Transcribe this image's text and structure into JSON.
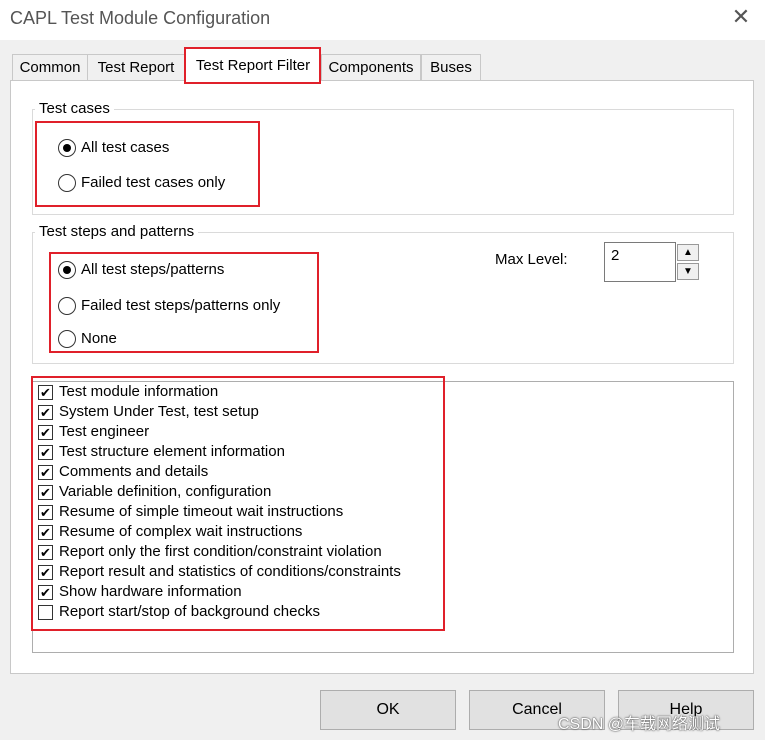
{
  "window": {
    "title": "CAPL Test Module Configuration",
    "close_glyph": "✕"
  },
  "tabs": [
    {
      "label": "Common"
    },
    {
      "label": "Test Report"
    },
    {
      "label": "Test Report Filter"
    },
    {
      "label": "Components"
    },
    {
      "label": "Buses"
    }
  ],
  "active_tab": "Test Report Filter",
  "test_cases": {
    "legend": "Test cases",
    "options": [
      {
        "label": "All test cases",
        "selected": true
      },
      {
        "label": "Failed test cases only",
        "selected": false
      }
    ]
  },
  "test_steps": {
    "legend": "Test steps and patterns",
    "options": [
      {
        "label": "All test steps/patterns",
        "selected": true
      },
      {
        "label": "Failed test steps/patterns only",
        "selected": false
      },
      {
        "label": "None",
        "selected": false
      }
    ],
    "max_level_label": "Max Level:",
    "max_level_value": "2"
  },
  "checklist": [
    {
      "label": "Test module information",
      "checked": true
    },
    {
      "label": "System Under Test, test setup",
      "checked": true
    },
    {
      "label": "Test engineer",
      "checked": true
    },
    {
      "label": "Test structure element information",
      "checked": true
    },
    {
      "label": "Comments and details",
      "checked": true
    },
    {
      "label": "Variable definition, configuration",
      "checked": true
    },
    {
      "label": "Resume of simple timeout wait instructions",
      "checked": true
    },
    {
      "label": "Resume of complex wait instructions",
      "checked": true
    },
    {
      "label": "Report only the first condition/constraint violation",
      "checked": true
    },
    {
      "label": "Report result and statistics of conditions/constraints",
      "checked": true
    },
    {
      "label": "Show hardware information",
      "checked": true
    },
    {
      "label": "Report start/stop of background checks",
      "checked": false
    }
  ],
  "buttons": {
    "ok": "OK",
    "cancel": "Cancel",
    "help": "Help"
  },
  "watermark": "CSDN @车载网络测试",
  "colors": {
    "highlight": "#e0202a",
    "background": "#f0f0f0"
  }
}
